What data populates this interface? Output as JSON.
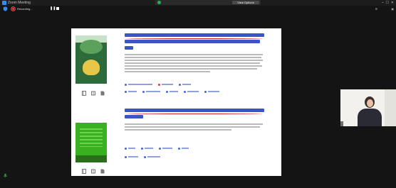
{
  "titlebar": {
    "app_title": "Zoom Meeting",
    "share_status": "",
    "view_options": "View Options"
  },
  "toolbar": {
    "recording_label": "Recording..."
  },
  "entries": [
    {
      "keywords": [
        "",
        "",
        "",
        ""
      ],
      "keywords_row2": [
        "",
        "",
        "",
        "",
        ""
      ]
    },
    {
      "keywords": [
        "",
        "",
        "",
        ""
      ],
      "keywords_row2": [
        "",
        ""
      ]
    }
  ],
  "participant": {
    "name": ""
  },
  "colors": {
    "zoom_blue": "#2d8cff",
    "share_green": "#22b14c",
    "link_blue": "#3a55c8",
    "annotation_red": "#d11c1c"
  },
  "icons": {
    "app": "zoom-logo-icon",
    "toolbar": [
      "shield-icon",
      "record-icon",
      "pause-icon",
      "stop-icon"
    ],
    "entry": [
      "book-icon",
      "grid-icon",
      "document-icon"
    ],
    "status": "mic-icon"
  }
}
